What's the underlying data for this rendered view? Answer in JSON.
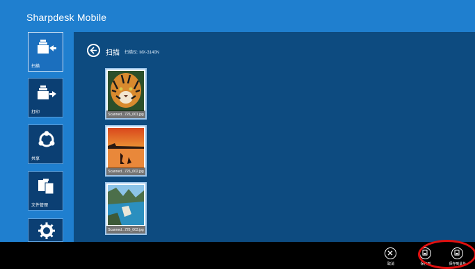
{
  "app": {
    "title": "Sharpdesk Mobile"
  },
  "sidebar": {
    "items": [
      {
        "label": "扫描",
        "icon": "scan-icon",
        "active": true
      },
      {
        "label": "打印",
        "icon": "print-icon",
        "active": false
      },
      {
        "label": "共享",
        "icon": "share-icon",
        "active": false
      },
      {
        "label": "文件管理",
        "icon": "file-management-icon",
        "active": false
      },
      {
        "label": "",
        "icon": "settings-icon",
        "active": false
      }
    ]
  },
  "header": {
    "title": "扫描",
    "scanner": "扫描仪: MX-3140N"
  },
  "thumbnails": [
    {
      "name": "Scanned...726_001.jpg",
      "subject": "tiger"
    },
    {
      "name": "Scanned...726_002.jpg",
      "subject": "sunset"
    },
    {
      "name": "Scanned...726_003.jpg",
      "subject": "coast"
    }
  ],
  "appbar": {
    "cancel_label": "取消",
    "save_label": "保存到",
    "save_to_label": "保存到此处"
  },
  "colors": {
    "background": "#1f7fcf",
    "panel": "#0d4b80",
    "tile": "#0b3f73",
    "highlight": "#e01010"
  }
}
